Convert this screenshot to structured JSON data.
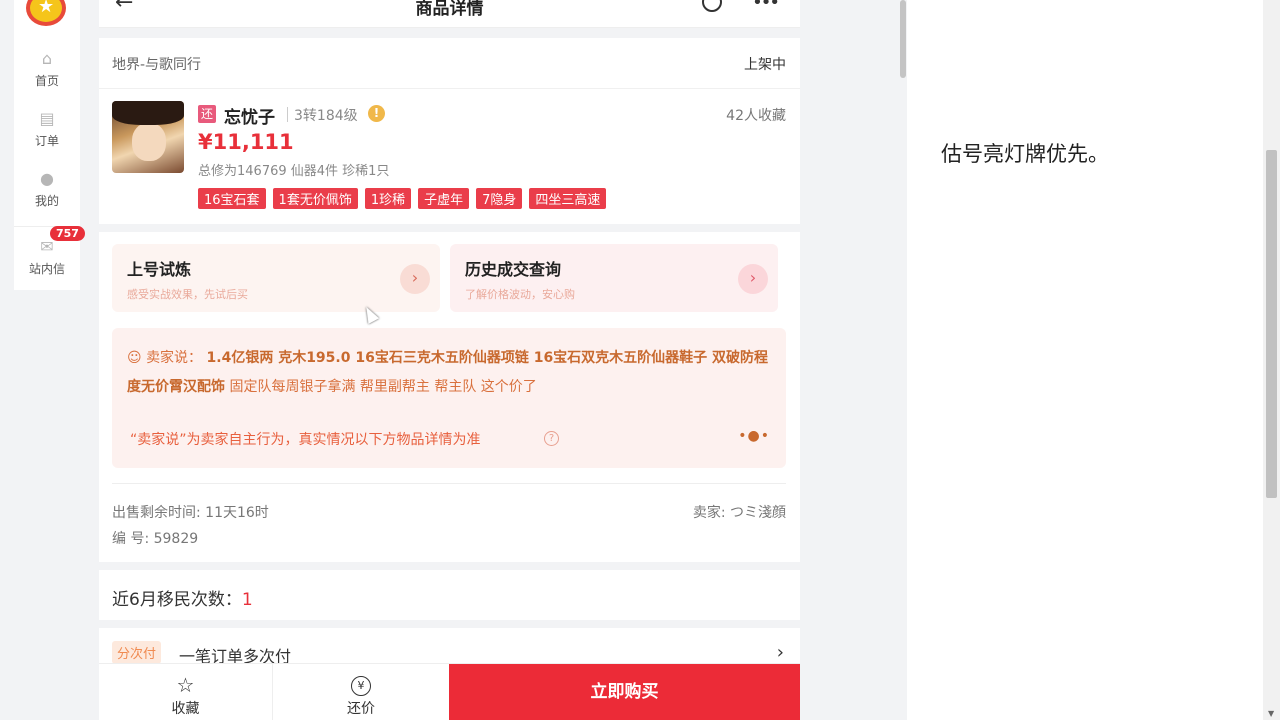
{
  "nav": {
    "items": [
      {
        "label": "首页",
        "icon": "home-icon"
      },
      {
        "label": "订单",
        "icon": "order-icon"
      },
      {
        "label": "我的",
        "icon": "user-icon"
      },
      {
        "label": "站内信",
        "icon": "mail-icon",
        "badge": "757"
      }
    ]
  },
  "header": {
    "title": "商品详情"
  },
  "product": {
    "server": "地界-与歌同行",
    "status": "上架中",
    "return_tag": "还",
    "name": "忘忧子",
    "level": "3转184级",
    "favorites": "42人收藏",
    "price": "¥11,111",
    "stats": "总修为146769  仙器4件  珍稀1只",
    "tags": [
      "16宝石套",
      "1套无价佩饰",
      "1珍稀",
      "子虚年",
      "7隐身",
      "四坐三高速"
    ]
  },
  "promos": [
    {
      "title": "上号试炼",
      "subtitle": "感受实战效果，先试后买"
    },
    {
      "title": "历史成交查询",
      "subtitle": "了解价格波动，安心购"
    }
  ],
  "seller_says": {
    "label": "卖家说：",
    "bold_text": "1.4亿银两 克木195.0 16宝石三克木五阶仙器项链 16宝石双克木五阶仙器鞋子 双破防程度无价霄汉配饰",
    "normal_text": "固定队每周银子拿满 帮里副帮主 帮主队 这个价了",
    "note": "“卖家说”为卖家自主行为，真实情况以下方物品详情为准"
  },
  "sale": {
    "remaining": "出售剩余时间: 11天16时",
    "seller": "卖家: つミ淺顔",
    "id": "编 号: 59829"
  },
  "migration": {
    "label": "近6月移民次数：",
    "count": "1"
  },
  "installment": {
    "chip": "分次付",
    "text": "一笔订单多次付"
  },
  "bottom": {
    "fav": "收藏",
    "bargain": "还价",
    "buy": "立即购买"
  },
  "right_panel": {
    "description": "估号亮灯牌优先。"
  },
  "colors": {
    "accent": "#ec2b37",
    "tag": "#ea3d4a",
    "seller_text": "#d9713e"
  }
}
